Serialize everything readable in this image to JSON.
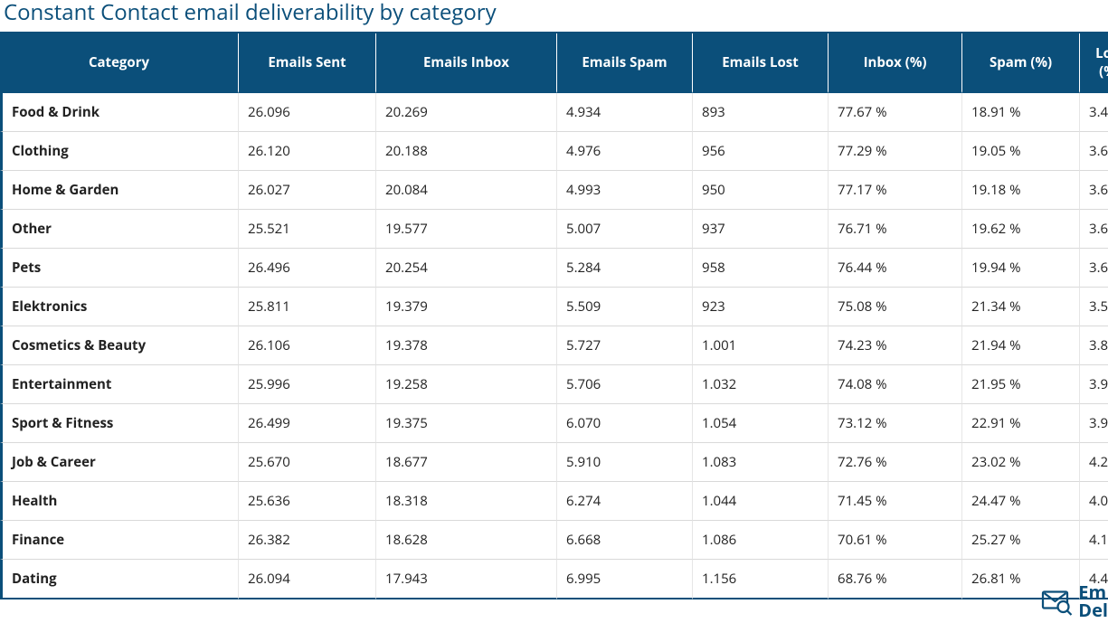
{
  "title": "Constant Contact email deliverability by category",
  "columns": [
    "Category",
    "Emails Sent",
    "Emails Inbox",
    "Emails Spam",
    "Emails Lost",
    "Inbox (%)",
    "Spam (%)",
    "Lost (%)"
  ],
  "rows": [
    {
      "category": "Food & Drink",
      "sent": "26.096",
      "inbox": "20.269",
      "spam": "4.934",
      "lost": "893",
      "inbox_pct": "77.67 %",
      "spam_pct": "18.91 %",
      "lost_pct": "3.4"
    },
    {
      "category": "Clothing",
      "sent": "26.120",
      "inbox": "20.188",
      "spam": "4.976",
      "lost": "956",
      "inbox_pct": "77.29 %",
      "spam_pct": "19.05 %",
      "lost_pct": "3.6"
    },
    {
      "category": "Home & Garden",
      "sent": "26.027",
      "inbox": "20.084",
      "spam": "4.993",
      "lost": "950",
      "inbox_pct": "77.17 %",
      "spam_pct": "19.18 %",
      "lost_pct": "3.6"
    },
    {
      "category": "Other",
      "sent": "25.521",
      "inbox": "19.577",
      "spam": "5.007",
      "lost": "937",
      "inbox_pct": "76.71 %",
      "spam_pct": "19.62 %",
      "lost_pct": "3.6"
    },
    {
      "category": "Pets",
      "sent": "26.496",
      "inbox": "20.254",
      "spam": "5.284",
      "lost": "958",
      "inbox_pct": "76.44 %",
      "spam_pct": "19.94 %",
      "lost_pct": "3.6"
    },
    {
      "category": "Elektronics",
      "sent": "25.811",
      "inbox": "19.379",
      "spam": "5.509",
      "lost": "923",
      "inbox_pct": "75.08 %",
      "spam_pct": "21.34 %",
      "lost_pct": "3.5"
    },
    {
      "category": "Cosmetics & Beauty",
      "sent": "26.106",
      "inbox": "19.378",
      "spam": "5.727",
      "lost": "1.001",
      "inbox_pct": "74.23 %",
      "spam_pct": "21.94 %",
      "lost_pct": "3.8"
    },
    {
      "category": "Entertainment",
      "sent": "25.996",
      "inbox": "19.258",
      "spam": "5.706",
      "lost": "1.032",
      "inbox_pct": "74.08 %",
      "spam_pct": "21.95 %",
      "lost_pct": "3.9"
    },
    {
      "category": "Sport & Fitness",
      "sent": "26.499",
      "inbox": "19.375",
      "spam": "6.070",
      "lost": "1.054",
      "inbox_pct": "73.12 %",
      "spam_pct": "22.91 %",
      "lost_pct": "3.9"
    },
    {
      "category": "Job & Career",
      "sent": "25.670",
      "inbox": "18.677",
      "spam": "5.910",
      "lost": "1.083",
      "inbox_pct": "72.76 %",
      "spam_pct": "23.02 %",
      "lost_pct": "4.2"
    },
    {
      "category": "Health",
      "sent": "25.636",
      "inbox": "18.318",
      "spam": "6.274",
      "lost": "1.044",
      "inbox_pct": "71.45 %",
      "spam_pct": "24.47 %",
      "lost_pct": "4.0"
    },
    {
      "category": "Finance",
      "sent": "26.382",
      "inbox": "18.628",
      "spam": "6.668",
      "lost": "1.086",
      "inbox_pct": "70.61 %",
      "spam_pct": "25.27 %",
      "lost_pct": "4.1"
    },
    {
      "category": "Dating",
      "sent": "26.094",
      "inbox": "17.943",
      "spam": "6.995",
      "lost": "1.156",
      "inbox_pct": "68.76 %",
      "spam_pct": "26.81 %",
      "lost_pct": "4.4"
    }
  ],
  "logo": {
    "line1": "Em",
    "line2": "Del"
  },
  "chart_data": {
    "type": "table",
    "title": "Constant Contact email deliverability by category",
    "columns": [
      "Category",
      "Emails Sent",
      "Emails Inbox",
      "Emails Spam",
      "Emails Lost",
      "Inbox (%)",
      "Spam (%)"
    ],
    "rows": [
      [
        "Food & Drink",
        26096,
        20269,
        4934,
        893,
        77.67,
        18.91
      ],
      [
        "Clothing",
        26120,
        20188,
        4976,
        956,
        77.29,
        19.05
      ],
      [
        "Home & Garden",
        26027,
        20084,
        4993,
        950,
        77.17,
        19.18
      ],
      [
        "Other",
        25521,
        19577,
        5007,
        937,
        76.71,
        19.62
      ],
      [
        "Pets",
        26496,
        20254,
        5284,
        958,
        76.44,
        19.94
      ],
      [
        "Elektronics",
        25811,
        19379,
        5509,
        923,
        75.08,
        21.34
      ],
      [
        "Cosmetics & Beauty",
        26106,
        19378,
        5727,
        1001,
        74.23,
        21.94
      ],
      [
        "Entertainment",
        25996,
        19258,
        5706,
        1032,
        74.08,
        21.95
      ],
      [
        "Sport & Fitness",
        26499,
        19375,
        6070,
        1054,
        73.12,
        22.91
      ],
      [
        "Job & Career",
        25670,
        18677,
        5910,
        1083,
        72.76,
        23.02
      ],
      [
        "Health",
        25636,
        18318,
        6274,
        1044,
        71.45,
        24.47
      ],
      [
        "Finance",
        26382,
        18628,
        6668,
        1086,
        70.61,
        25.27
      ],
      [
        "Dating",
        26094,
        17943,
        6995,
        1156,
        68.76,
        26.81
      ]
    ]
  }
}
